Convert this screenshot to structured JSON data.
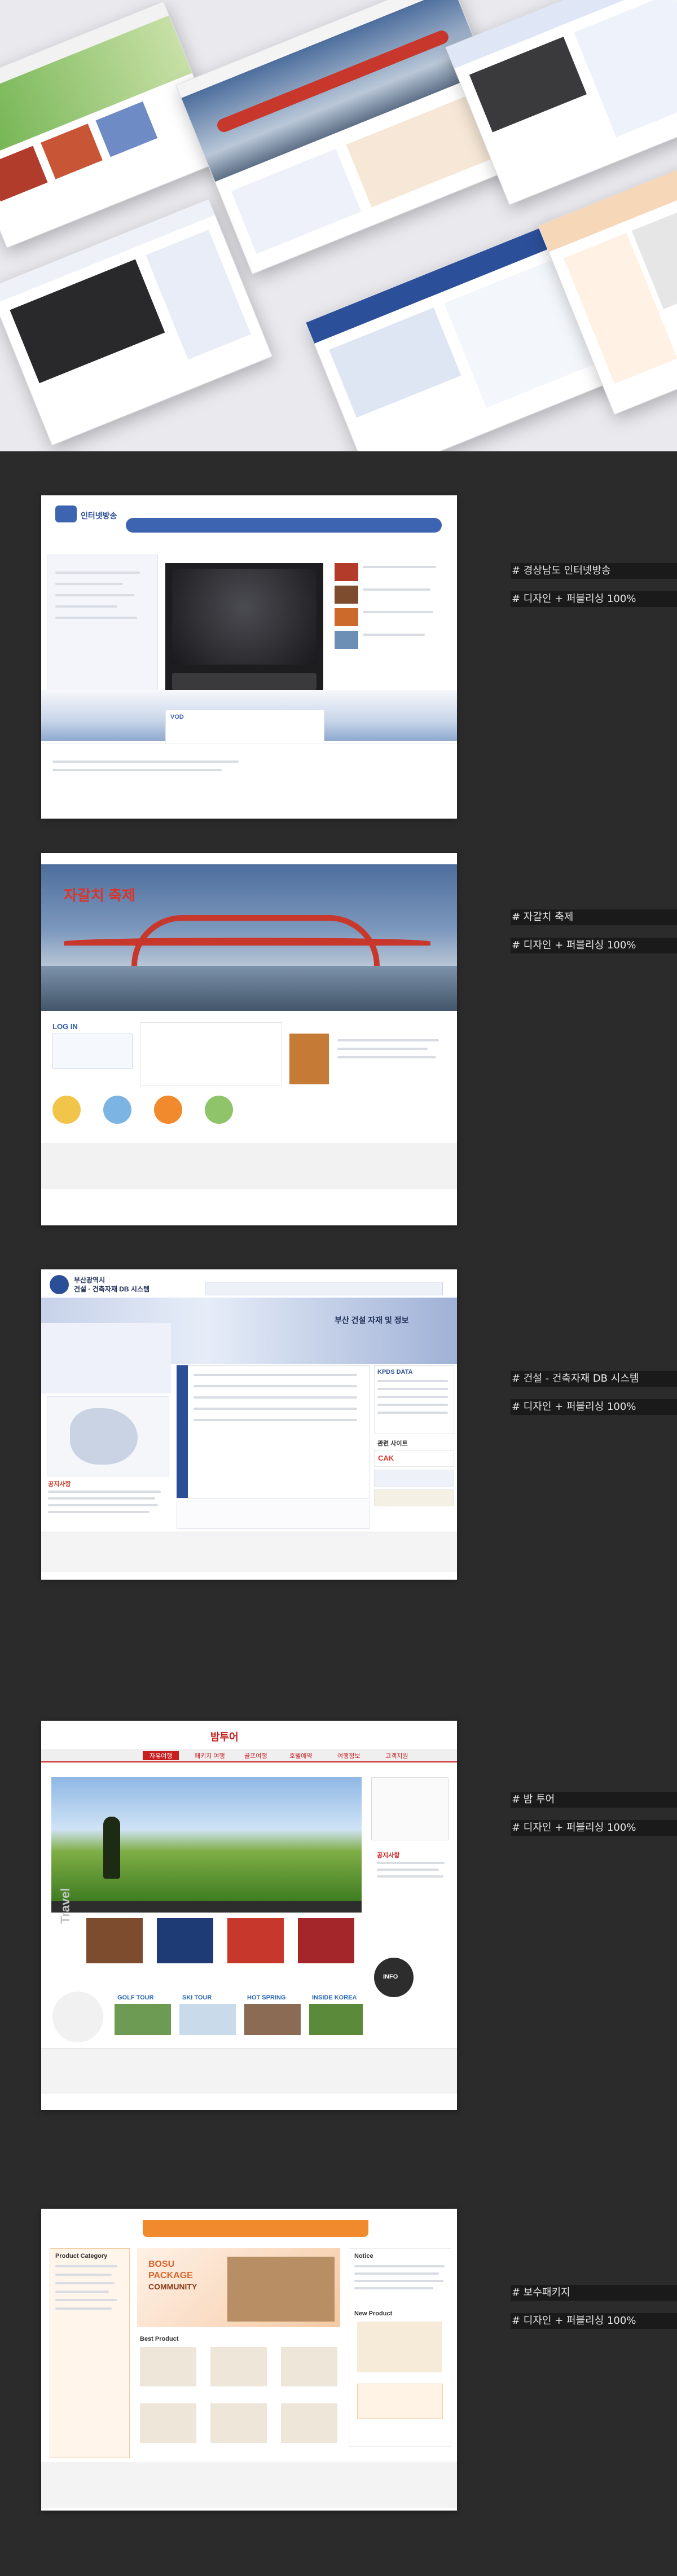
{
  "projects": [
    {
      "title": "# 경상남도 인터넷방송",
      "role": "# 디자인 + 퍼블리싱 100%"
    },
    {
      "title": "# 자갈치 축제",
      "role": "# 디자인 + 퍼블리싱 100%"
    },
    {
      "title": "# 건설 - 건축자재 DB 시스템",
      "role": "# 디자인 + 퍼블리싱 100%"
    },
    {
      "title": "# 밤 투어",
      "role": "# 디자인 + 퍼블리싱 100%"
    },
    {
      "title": "# 보수패키지",
      "role": "# 디자인 + 퍼블리싱 100%"
    }
  ],
  "sites": {
    "broadcast": {
      "brand": "인터넷방송",
      "vod_label": "VOD"
    },
    "festival": {
      "headline": "자갈치 축제",
      "login": "LOG IN"
    },
    "construction": {
      "org": "부산광역시",
      "system": "건설 · 건축자재 DB 시스템",
      "banner": "부산 건설 자재 및 정보",
      "kpds": "KPDS DATA",
      "related": "관련 사이트",
      "cak": "CAK",
      "notice": "공지사항"
    },
    "tour": {
      "brand": "밤투어",
      "tabs": [
        "자유여행",
        "패키지 여행",
        "골프여행",
        "호텔예약",
        "여행정보",
        "고객지원"
      ],
      "section": "Travel",
      "golf": "GOLF TOUR",
      "ski": "SKI TOUR",
      "spring": "HOT SPRING",
      "korea": "INSIDE KOREA",
      "notice": "공지사항",
      "info": "INFO"
    },
    "package": {
      "category": "Product Category",
      "banner1": "BOSU",
      "banner2": "PACKAGE",
      "banner3": "COMMUNITY",
      "best": "Best Product",
      "notice": "Notice",
      "newp": "New Product"
    }
  }
}
